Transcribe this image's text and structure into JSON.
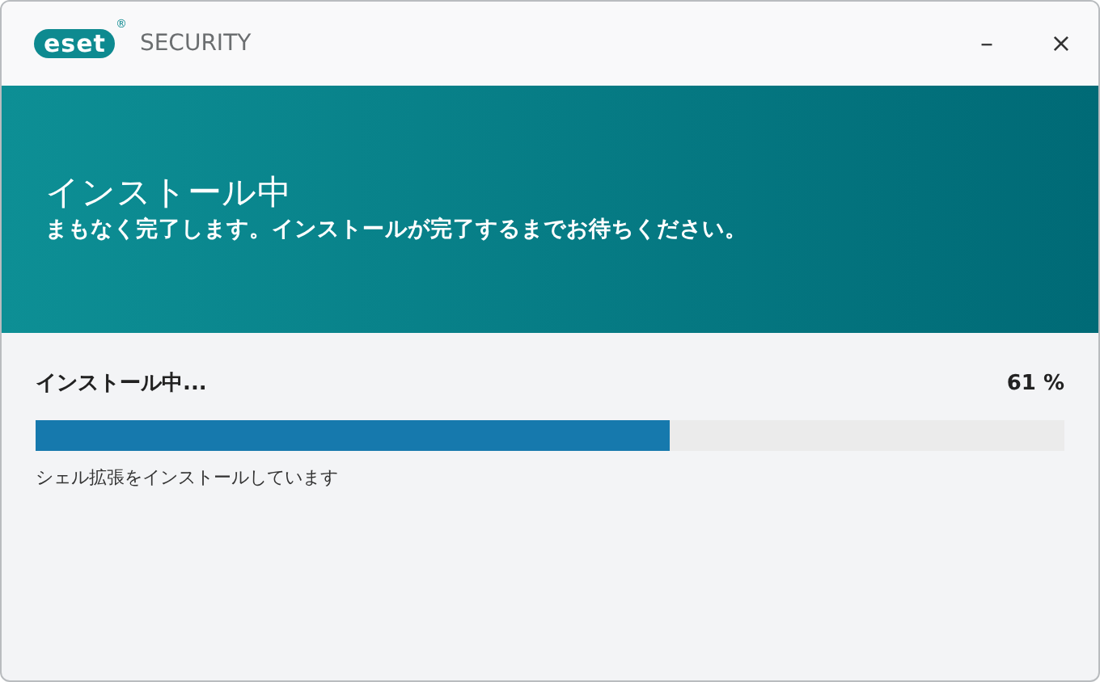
{
  "window": {
    "logo": {
      "mark": "eset",
      "registered": "®",
      "product": "SECURITY"
    },
    "controls": [
      "–",
      "×"
    ]
  },
  "banner": {
    "title": "インストール中",
    "subtitle": "まもなく完了します。インストールが完了するまでお待ちください。"
  },
  "progress": {
    "label": "インストール中...",
    "reading": "61 %",
    "level": 0.617,
    "detail": "シェル拡張をインストールしています"
  }
}
